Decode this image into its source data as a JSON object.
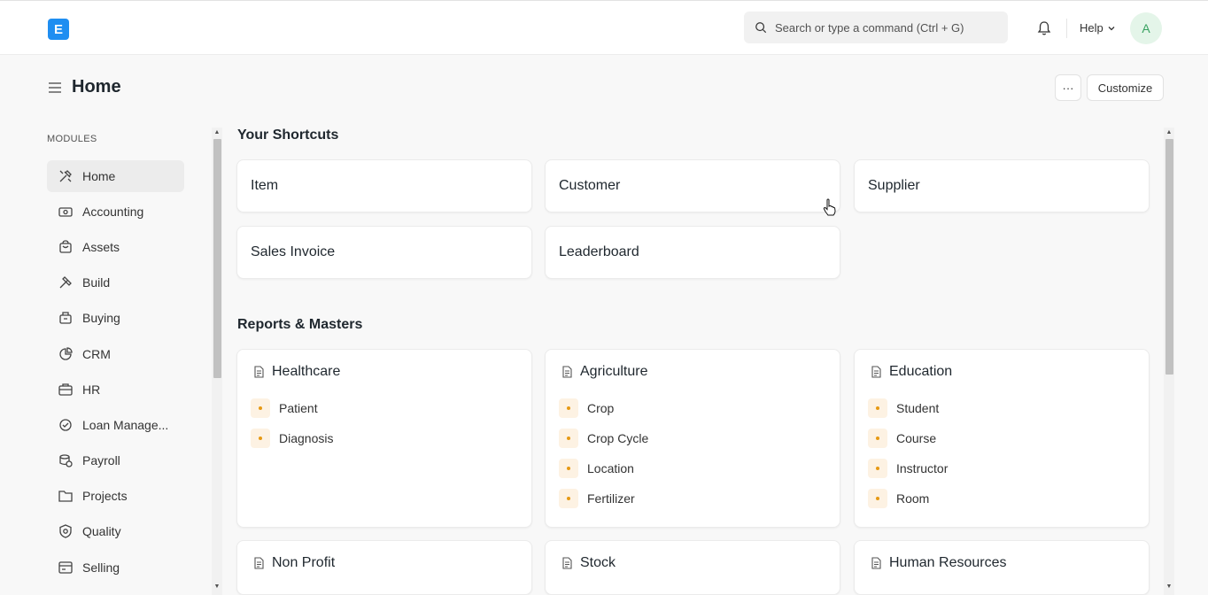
{
  "navbar": {
    "logo_letter": "E",
    "search_placeholder": "Search or type a command (Ctrl + G)",
    "help_label": "Help",
    "avatar_initial": "A"
  },
  "page": {
    "title": "Home",
    "more_label": "···",
    "customize_label": "Customize"
  },
  "sidebar": {
    "heading": "MODULES",
    "items": [
      {
        "label": "Home",
        "icon": "tools-icon",
        "active": true
      },
      {
        "label": "Accounting",
        "icon": "money-icon"
      },
      {
        "label": "Assets",
        "icon": "assets-icon"
      },
      {
        "label": "Build",
        "icon": "build-icon"
      },
      {
        "label": "Buying",
        "icon": "buying-icon"
      },
      {
        "label": "CRM",
        "icon": "crm-icon"
      },
      {
        "label": "HR",
        "icon": "hr-icon"
      },
      {
        "label": "Loan Manage...",
        "icon": "loan-icon"
      },
      {
        "label": "Payroll",
        "icon": "payroll-icon"
      },
      {
        "label": "Projects",
        "icon": "folder-icon"
      },
      {
        "label": "Quality",
        "icon": "quality-icon"
      },
      {
        "label": "Selling",
        "icon": "selling-icon"
      }
    ]
  },
  "shortcuts": {
    "title": "Your Shortcuts",
    "items": [
      "Item",
      "Customer",
      "Supplier",
      "Sales Invoice",
      "Leaderboard"
    ]
  },
  "reports": {
    "title": "Reports & Masters",
    "cards": [
      {
        "title": "Healthcare",
        "links": [
          "Patient",
          "Diagnosis"
        ]
      },
      {
        "title": "Agriculture",
        "links": [
          "Crop",
          "Crop Cycle",
          "Location",
          "Fertilizer"
        ]
      },
      {
        "title": "Education",
        "links": [
          "Student",
          "Course",
          "Instructor",
          "Room"
        ]
      },
      {
        "title": "Non Profit",
        "links": []
      },
      {
        "title": "Stock",
        "links": []
      },
      {
        "title": "Human Resources",
        "links": []
      }
    ]
  },
  "colors": {
    "accent": "#1f8ef1",
    "link_dot": "#e79913",
    "avatar_bg": "#e4f5e9",
    "avatar_fg": "#38a160"
  }
}
